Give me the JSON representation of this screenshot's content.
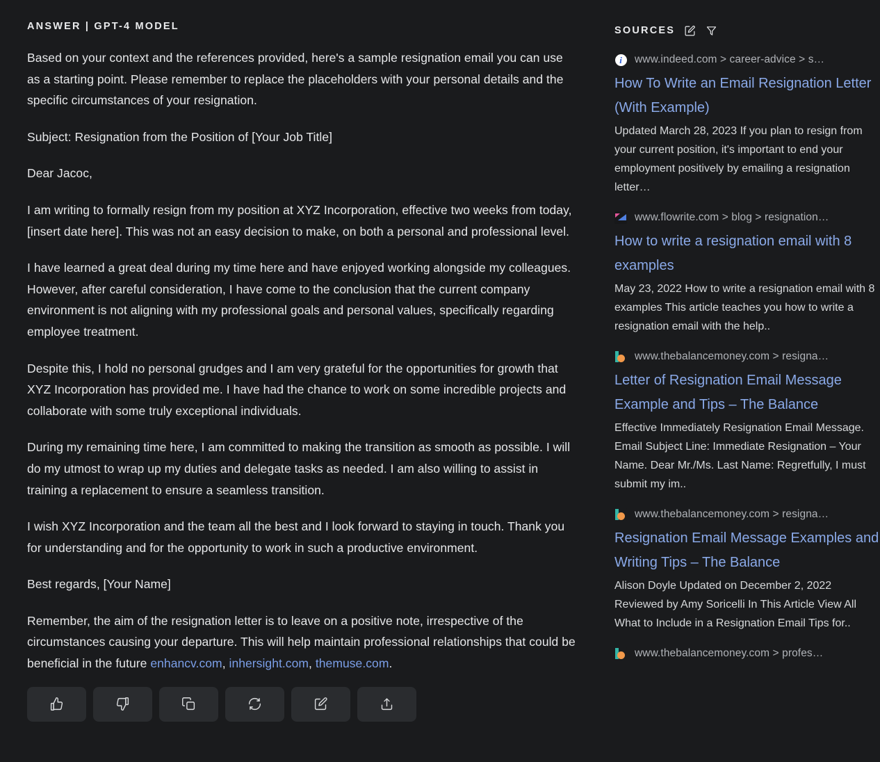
{
  "answer": {
    "header": "ANSWER | GPT-4 MODEL",
    "paragraphs": [
      "Based on your context and the references provided, here's a sample resignation email you can use as a starting point. Please remember to replace the placeholders with your personal details and the specific circumstances of your resignation.",
      "Subject: Resignation from the Position of [Your Job Title]",
      "Dear Jacoc,",
      "I am writing to formally resign from my position at XYZ Incorporation, effective two weeks from today, [insert date here]. This was not an easy decision to make, on both a personal and professional level.",
      "I have learned a great deal during my time here and have enjoyed working alongside my colleagues. However, after careful consideration, I have come to the conclusion that the current company environment is not aligning with my professional goals and personal values, specifically regarding employee treatment.",
      "Despite this, I hold no personal grudges and I am very grateful for the opportunities for growth that XYZ Incorporation has provided me. I have had the chance to work on some incredible projects and collaborate with some truly exceptional individuals.",
      "During my remaining time here, I am committed to making the transition as smooth as possible. I will do my utmost to wrap up my duties and delegate tasks as needed. I am also willing to assist in training a replacement to ensure a seamless transition.",
      "I wish XYZ Incorporation and the team all the best and I look forward to staying in touch. Thank you for understanding and for the opportunity to work in such a productive environment.",
      "Best regards, [Your Name]"
    ],
    "final_paragraph": {
      "lead": "Remember, the aim of the resignation letter is to leave on a positive note, irrespective of the circumstances causing your departure. This will help maintain professional relationships that could be beneficial in the future ",
      "links": [
        "enhancv.com",
        "inhersight.com",
        "themuse.com"
      ],
      "separator": ", ",
      "trailing": "."
    },
    "link_color": "#7b9fe8"
  },
  "actions": [
    {
      "name": "thumbs-up",
      "label": "Good response"
    },
    {
      "name": "thumbs-down",
      "label": "Bad response"
    },
    {
      "name": "copy",
      "label": "Copy"
    },
    {
      "name": "regenerate",
      "label": "Regenerate"
    },
    {
      "name": "edit",
      "label": "Edit"
    },
    {
      "name": "share",
      "label": "Share"
    }
  ],
  "sources": {
    "title": "SOURCES",
    "header_icons": [
      {
        "name": "edit-icon",
        "label": "Edit sources"
      },
      {
        "name": "filter-icon",
        "label": "Filter sources"
      }
    ],
    "items": [
      {
        "favicon": "indeed",
        "url": "www.indeed.com > career-advice > s…",
        "title": "How To Write an Email Resignation Letter (With Example)",
        "snippet": "Updated March 28, 2023 If you plan to resign from your current position, it's important to end your employment positively by emailing a resignation letter…"
      },
      {
        "favicon": "flowrite",
        "url": "www.flowrite.com > blog > resignation…",
        "title": "How to write a resignation email with 8 examples",
        "snippet": "May 23, 2022 How to write a resignation email with 8 examples This article teaches you how to write a resignation email with the help.."
      },
      {
        "favicon": "balance",
        "url": "www.thebalancemoney.com > resigna…",
        "title": "Letter of Resignation Email Message Example and Tips – The Balance",
        "snippet": "Effective Immediately Resignation Email Message. Email Subject Line: Immediate Resignation – Your Name. Dear Mr./Ms. Last Name: Regretfully, I must submit my im.."
      },
      {
        "favicon": "balance",
        "url": "www.thebalancemoney.com > resigna…",
        "title": "Resignation Email Message Examples and Writing Tips – The Balance",
        "snippet": "Alison Doyle Updated on December 2, 2022 Reviewed by Amy Soricelli In This Article View All What to Include in a Resignation Email Tips for.."
      },
      {
        "favicon": "balance",
        "url": "www.thebalancemoney.com > profes…",
        "title": "",
        "snippet": ""
      }
    ]
  },
  "theme": {
    "background": "#1a1b1d",
    "text": "#e6e7e9",
    "muted": "#b0b3b8",
    "link": "#8aa9e8",
    "button_bg": "#2a2c2f"
  }
}
